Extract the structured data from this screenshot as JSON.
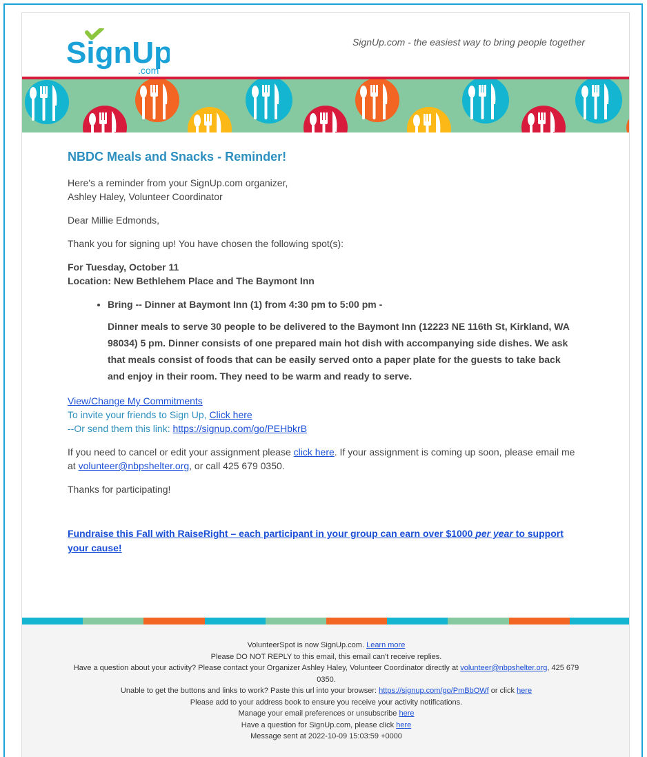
{
  "header": {
    "logo_text": "SignUp",
    "logo_sub": ".com",
    "tagline": "SignUp.com - the easiest way to bring people together"
  },
  "colors": {
    "accent_blue": "#1aa2d8",
    "title_blue": "#2c8fbf",
    "logo_green": "#8cc63f",
    "red": "#d81b3c",
    "orange": "#f26522",
    "yellow": "#fbb817",
    "teal": "#13b5d1",
    "mint": "#86c9a0",
    "link": "#1a4fd6"
  },
  "banner": {
    "icons": [
      "fork-knife-spoon-icon",
      "fork-knife-spoon-icon",
      "fork-knife-spoon-icon",
      "fork-knife-spoon-icon",
      "fork-knife-spoon-icon",
      "fork-knife-spoon-icon",
      "fork-knife-spoon-icon",
      "fork-knife-spoon-icon",
      "fork-knife-spoon-icon",
      "fork-knife-spoon-icon",
      "fork-knife-spoon-icon"
    ]
  },
  "email": {
    "title": "NBDC Meals and Snacks - Reminder!",
    "intro_line1": "Here's a reminder from your SignUp.com organizer,",
    "intro_line2": "Ashley Haley, Volunteer Coordinator",
    "greeting": "Dear Millie Edmonds,",
    "thanks_signup": "Thank you for signing up! You have chosen the following spot(s):",
    "date_line": "For Tuesday, October 11",
    "location_line": "Location: New Bethlehem Place and The Baymont Inn",
    "spot_item": "Bring -- Dinner at Baymont Inn (1) from 4:30 pm to 5:00 pm -",
    "spot_description": "Dinner meals to serve 30 people to be delivered to the Baymont Inn (12223 NE 116th St, Kirkland, WA 98034) 5 pm. Dinner consists of one prepared main hot dish with accompanying side dishes. We ask that meals consist of foods that can be easily served onto a paper plate for the guests to take back and enjoy in their room. They need to be warm and ready to serve.",
    "view_change_link": "View/Change My Commitments",
    "invite_text": "To invite your friends to Sign Up,",
    "invite_link": "Click here",
    "send_link_text": "--Or send them this link:",
    "send_link_url": "https://signup.com/go/PEHbkrB",
    "cancel_text1": "If you need to cancel or edit your assignment please",
    "cancel_link": "click here",
    "cancel_text2": ". If your assignment is coming up soon, please email me at",
    "email_link": "volunteer@nbpshelter.org",
    "cancel_text3": ", or call 425 679 0350.",
    "thanks_participating": "Thanks for participating!",
    "promo_part1": "Fundraise this Fall with RaiseRight – each participant in your group can earn over $1000",
    "promo_italic": "per year",
    "promo_part2": "to support your cause!"
  },
  "footer": {
    "line1_text": "VolunteerSpot is now SignUp.com.",
    "line1_link": "Learn more",
    "line2": "Please DO NOT REPLY to this email, this email can't receive replies.",
    "line3_text": "Have a question about your activity? Please contact your Organizer Ashley Haley, Volunteer Coordinator directly at",
    "line3_link": "volunteer@nbpshelter.org",
    "line3_phone": ", 425 679 0350.",
    "line4_text": "Unable to get the buttons and links to work?  Paste this url into your browser:",
    "line4_url": "https://signup.com/go/PmBbOWf",
    "line4_or": "or click",
    "line4_link": "here",
    "line5": "Please add to your address book to ensure you receive your activity notifications.",
    "line6_text": "Manage your email preferences or unsubscribe",
    "line6_link": "here",
    "line7_text": "Have a question for SignUp.com, please click",
    "line7_link": "here",
    "line8": "Message sent at 2022-10-09 15:03:59 +0000"
  }
}
